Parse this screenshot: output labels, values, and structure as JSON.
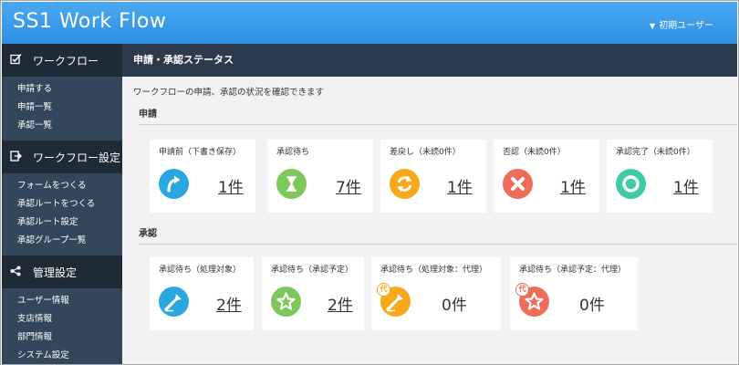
{
  "header": {
    "logo": "SS1 Work Flow",
    "user": "初期ユーザー"
  },
  "sidebar": {
    "sections": [
      {
        "label": "ワークフロー",
        "icon": "checkbox-edit-icon",
        "items": [
          "申請する",
          "申請一覧",
          "承認一覧"
        ]
      },
      {
        "label": "ワークフロー設定",
        "icon": "form-arrow-icon",
        "items": [
          "フォームをつくる",
          "承認ルートをつくる",
          "承認ルート設定",
          "承認グループ一覧"
        ]
      },
      {
        "label": "管理設定",
        "icon": "share-icon",
        "items": [
          "ユーザー情報",
          "支店情報",
          "部門情報",
          "システム設定"
        ]
      }
    ]
  },
  "main": {
    "title": "申請・承認ステータス",
    "description": "ワークフローの申請、承認の状況を確認できます",
    "application": {
      "label": "申請",
      "cards": [
        {
          "title": "申請前（下書き保存）",
          "count": "1件",
          "color": "#2aa7e0",
          "icon": "curved-arrow-icon"
        },
        {
          "title": "承認待ち",
          "count": "7件",
          "color": "#7cc85a",
          "icon": "hourglass-icon"
        },
        {
          "title": "差戻し（未読0件）",
          "count": "1件",
          "color": "#f7a81b",
          "icon": "return-arrows-icon"
        },
        {
          "title": "否認（未読0件）",
          "count": "1件",
          "color": "#ef6b5a",
          "icon": "cross-icon"
        },
        {
          "title": "承認完了（未読0件）",
          "count": "1件",
          "color": "#3ecba5",
          "icon": "ring-icon"
        }
      ]
    },
    "approval": {
      "label": "承認",
      "cards": [
        {
          "title": "承認待ち（処理対象）",
          "count": "2件",
          "color": "#2aa7e0",
          "icon": "stamp-icon",
          "badge": ""
        },
        {
          "title": "承認待ち（承認予定）",
          "count": "2件",
          "color": "#7cc85a",
          "icon": "star-icon",
          "badge": ""
        },
        {
          "title": "承認待ち（処理対象：代理）",
          "count": "0件",
          "color": "#f7a81b",
          "icon": "stamp-icon",
          "badge": "代"
        },
        {
          "title": "承認待ち（承認予定：代理）",
          "count": "0件",
          "color": "#ef6b5a",
          "icon": "star-icon",
          "badge": "代"
        }
      ]
    }
  }
}
